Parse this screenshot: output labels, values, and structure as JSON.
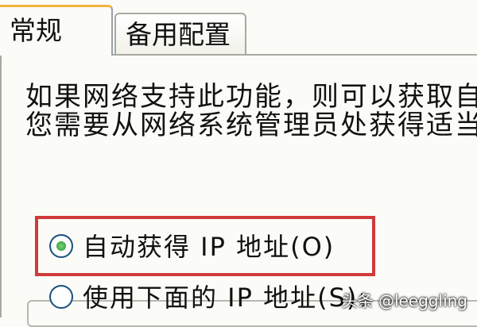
{
  "tabs": [
    {
      "label": "常规",
      "active": true
    },
    {
      "label": "备用配置",
      "active": false
    }
  ],
  "description": {
    "line1": "如果网络支持此功能，则可以获取自",
    "line2": "您需要从网络系统管理员处获得适当"
  },
  "options": {
    "auto_ip": {
      "label": "自动获得 IP 地址(O)",
      "selected": true
    },
    "manual_ip": {
      "label": "使用下面的 IP 地址(S):",
      "selected": false
    }
  },
  "highlight_color": "#d03a3a",
  "watermark": "头条 @leeggling"
}
